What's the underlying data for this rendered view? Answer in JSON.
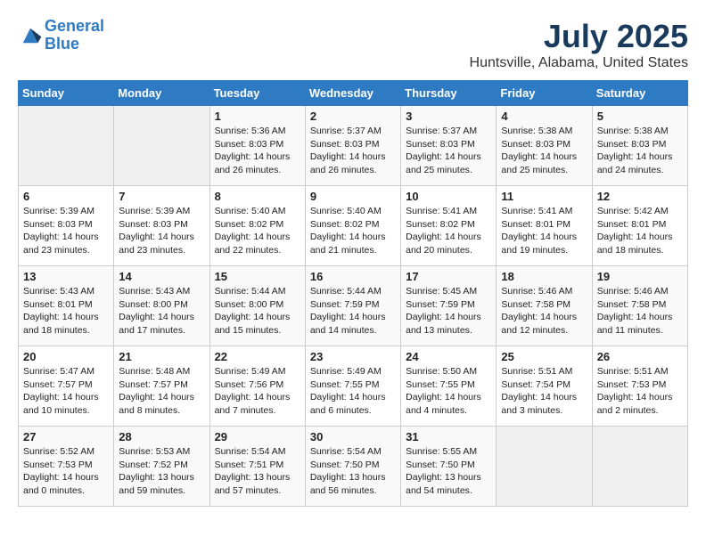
{
  "header": {
    "logo_line1": "General",
    "logo_line2": "Blue",
    "title": "July 2025",
    "subtitle": "Huntsville, Alabama, United States"
  },
  "calendar": {
    "weekdays": [
      "Sunday",
      "Monday",
      "Tuesday",
      "Wednesday",
      "Thursday",
      "Friday",
      "Saturday"
    ],
    "weeks": [
      [
        {
          "day": "",
          "content": ""
        },
        {
          "day": "",
          "content": ""
        },
        {
          "day": "1",
          "content": "Sunrise: 5:36 AM\nSunset: 8:03 PM\nDaylight: 14 hours and 26 minutes."
        },
        {
          "day": "2",
          "content": "Sunrise: 5:37 AM\nSunset: 8:03 PM\nDaylight: 14 hours and 26 minutes."
        },
        {
          "day": "3",
          "content": "Sunrise: 5:37 AM\nSunset: 8:03 PM\nDaylight: 14 hours and 25 minutes."
        },
        {
          "day": "4",
          "content": "Sunrise: 5:38 AM\nSunset: 8:03 PM\nDaylight: 14 hours and 25 minutes."
        },
        {
          "day": "5",
          "content": "Sunrise: 5:38 AM\nSunset: 8:03 PM\nDaylight: 14 hours and 24 minutes."
        }
      ],
      [
        {
          "day": "6",
          "content": "Sunrise: 5:39 AM\nSunset: 8:03 PM\nDaylight: 14 hours and 23 minutes."
        },
        {
          "day": "7",
          "content": "Sunrise: 5:39 AM\nSunset: 8:03 PM\nDaylight: 14 hours and 23 minutes."
        },
        {
          "day": "8",
          "content": "Sunrise: 5:40 AM\nSunset: 8:02 PM\nDaylight: 14 hours and 22 minutes."
        },
        {
          "day": "9",
          "content": "Sunrise: 5:40 AM\nSunset: 8:02 PM\nDaylight: 14 hours and 21 minutes."
        },
        {
          "day": "10",
          "content": "Sunrise: 5:41 AM\nSunset: 8:02 PM\nDaylight: 14 hours and 20 minutes."
        },
        {
          "day": "11",
          "content": "Sunrise: 5:41 AM\nSunset: 8:01 PM\nDaylight: 14 hours and 19 minutes."
        },
        {
          "day": "12",
          "content": "Sunrise: 5:42 AM\nSunset: 8:01 PM\nDaylight: 14 hours and 18 minutes."
        }
      ],
      [
        {
          "day": "13",
          "content": "Sunrise: 5:43 AM\nSunset: 8:01 PM\nDaylight: 14 hours and 18 minutes."
        },
        {
          "day": "14",
          "content": "Sunrise: 5:43 AM\nSunset: 8:00 PM\nDaylight: 14 hours and 17 minutes."
        },
        {
          "day": "15",
          "content": "Sunrise: 5:44 AM\nSunset: 8:00 PM\nDaylight: 14 hours and 15 minutes."
        },
        {
          "day": "16",
          "content": "Sunrise: 5:44 AM\nSunset: 7:59 PM\nDaylight: 14 hours and 14 minutes."
        },
        {
          "day": "17",
          "content": "Sunrise: 5:45 AM\nSunset: 7:59 PM\nDaylight: 14 hours and 13 minutes."
        },
        {
          "day": "18",
          "content": "Sunrise: 5:46 AM\nSunset: 7:58 PM\nDaylight: 14 hours and 12 minutes."
        },
        {
          "day": "19",
          "content": "Sunrise: 5:46 AM\nSunset: 7:58 PM\nDaylight: 14 hours and 11 minutes."
        }
      ],
      [
        {
          "day": "20",
          "content": "Sunrise: 5:47 AM\nSunset: 7:57 PM\nDaylight: 14 hours and 10 minutes."
        },
        {
          "day": "21",
          "content": "Sunrise: 5:48 AM\nSunset: 7:57 PM\nDaylight: 14 hours and 8 minutes."
        },
        {
          "day": "22",
          "content": "Sunrise: 5:49 AM\nSunset: 7:56 PM\nDaylight: 14 hours and 7 minutes."
        },
        {
          "day": "23",
          "content": "Sunrise: 5:49 AM\nSunset: 7:55 PM\nDaylight: 14 hours and 6 minutes."
        },
        {
          "day": "24",
          "content": "Sunrise: 5:50 AM\nSunset: 7:55 PM\nDaylight: 14 hours and 4 minutes."
        },
        {
          "day": "25",
          "content": "Sunrise: 5:51 AM\nSunset: 7:54 PM\nDaylight: 14 hours and 3 minutes."
        },
        {
          "day": "26",
          "content": "Sunrise: 5:51 AM\nSunset: 7:53 PM\nDaylight: 14 hours and 2 minutes."
        }
      ],
      [
        {
          "day": "27",
          "content": "Sunrise: 5:52 AM\nSunset: 7:53 PM\nDaylight: 14 hours and 0 minutes."
        },
        {
          "day": "28",
          "content": "Sunrise: 5:53 AM\nSunset: 7:52 PM\nDaylight: 13 hours and 59 minutes."
        },
        {
          "day": "29",
          "content": "Sunrise: 5:54 AM\nSunset: 7:51 PM\nDaylight: 13 hours and 57 minutes."
        },
        {
          "day": "30",
          "content": "Sunrise: 5:54 AM\nSunset: 7:50 PM\nDaylight: 13 hours and 56 minutes."
        },
        {
          "day": "31",
          "content": "Sunrise: 5:55 AM\nSunset: 7:50 PM\nDaylight: 13 hours and 54 minutes."
        },
        {
          "day": "",
          "content": ""
        },
        {
          "day": "",
          "content": ""
        }
      ]
    ]
  }
}
